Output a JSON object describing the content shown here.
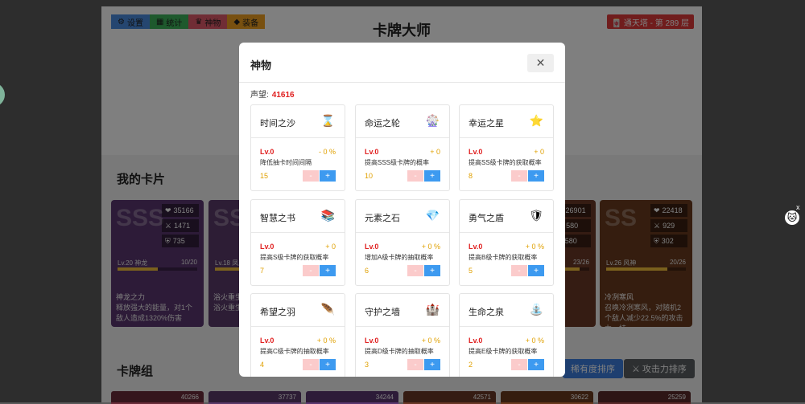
{
  "top_buttons": [
    {
      "icon": "⚙",
      "label": "设置",
      "color": "#4a8de0"
    },
    {
      "icon": "▦",
      "label": "统计",
      "color": "#3cb35a"
    },
    {
      "icon": "♛",
      "label": "神物",
      "color": "#e05a6a"
    },
    {
      "icon": "◆",
      "label": "装备",
      "color": "#f0a020"
    }
  ],
  "app_title": "卡牌大师",
  "tower_label": "🀄 通天塔 - 第 289 层",
  "my_cards_title": "我的卡片",
  "deck_title": "卡牌组",
  "cards": [
    {
      "rank": "SSS",
      "hp": "35166",
      "atk": "1471",
      "def": "735",
      "level": "Lv.20 神龙",
      "progress": "10/20",
      "progress_pct": 0.5,
      "skill": "神龙之力",
      "desc": "释放强大的能量，对1个敌人造成1320%伤害",
      "color": "#5b3770"
    },
    {
      "rank": "SS",
      "hp": "",
      "atk": "",
      "def": "",
      "level": "Lv.18 凤凰",
      "progress": "",
      "progress_pct": 0.4,
      "skill": "浴火重生",
      "desc": "浴火重生，命值的2%",
      "color": "#5a3a6a"
    },
    {
      "rank": "SS",
      "hp": "26901",
      "atk": "580",
      "def": "580",
      "level": "",
      "progress": "23/26",
      "progress_pct": 0.88,
      "skill": "",
      "desc": "4个敌攻击",
      "color": "#6a3826"
    },
    {
      "rank": "SS",
      "hp": "22418",
      "atk": "929",
      "def": "302",
      "level": "Lv.26 风神",
      "progress": "20/26",
      "progress_pct": 0.77,
      "skill": "冷冽寒风",
      "desc": "召唤冷冽寒风，对随机2个敌人减少22.5%的攻击力，持...",
      "color": "#6a3a1e"
    }
  ],
  "sort_buttons": [
    {
      "label": "稀有度排序",
      "color": "#3d7fe0"
    },
    {
      "label": "⚔ 攻击力排序",
      "color": "#5a5e63"
    }
  ],
  "deck_values": [
    "40266",
    "37737",
    "34244",
    "42571",
    "30622",
    "25259"
  ],
  "modal": {
    "title": "神物",
    "close_label": "✕",
    "prestige_label": "声望:",
    "prestige_value": "41616",
    "artifacts": [
      {
        "name": "时间之沙",
        "icon": "⌛",
        "level": "Lv.0",
        "bonus": "- 0 %",
        "desc": "降低抽卡时间间隔",
        "cost": "15"
      },
      {
        "name": "命运之轮",
        "icon": "🎡",
        "level": "Lv.0",
        "bonus": "+ 0",
        "desc": "提高SSS级卡牌的概率",
        "cost": "10"
      },
      {
        "name": "幸运之星",
        "icon": "⭐",
        "level": "Lv.0",
        "bonus": "+ 0",
        "desc": "提高SS级卡牌的获取概率",
        "cost": "8"
      },
      {
        "name": "智慧之书",
        "icon": "📚",
        "level": "Lv.0",
        "bonus": "+ 0",
        "desc": "提高S级卡牌的获取概率",
        "cost": "7"
      },
      {
        "name": "元素之石",
        "icon": "💎",
        "level": "Lv.0",
        "bonus": "+ 0 %",
        "desc": "增加A级卡牌的抽取概率",
        "cost": "6"
      },
      {
        "name": "勇气之盾",
        "icon": "🛡",
        "level": "Lv.0",
        "bonus": "+ 0 %",
        "desc": "提高B级卡牌的获取概率",
        "cost": "5"
      },
      {
        "name": "希望之羽",
        "icon": "🪶",
        "level": "Lv.0",
        "bonus": "+ 0 %",
        "desc": "提高C级卡牌的抽取概率",
        "cost": "4"
      },
      {
        "name": "守护之墙",
        "icon": "🏰",
        "level": "Lv.0",
        "bonus": "+ 0 %",
        "desc": "提高D级卡牌的抽取概率",
        "cost": "3"
      },
      {
        "name": "生命之泉",
        "icon": "⛲",
        "level": "Lv.0",
        "bonus": "+ 0 %",
        "desc": "提高E级卡牌的获取概率",
        "cost": "2"
      }
    ],
    "minus_label": "-",
    "plus_label": "+"
  },
  "side_widget": {
    "face": "🐱",
    "close": "x"
  }
}
